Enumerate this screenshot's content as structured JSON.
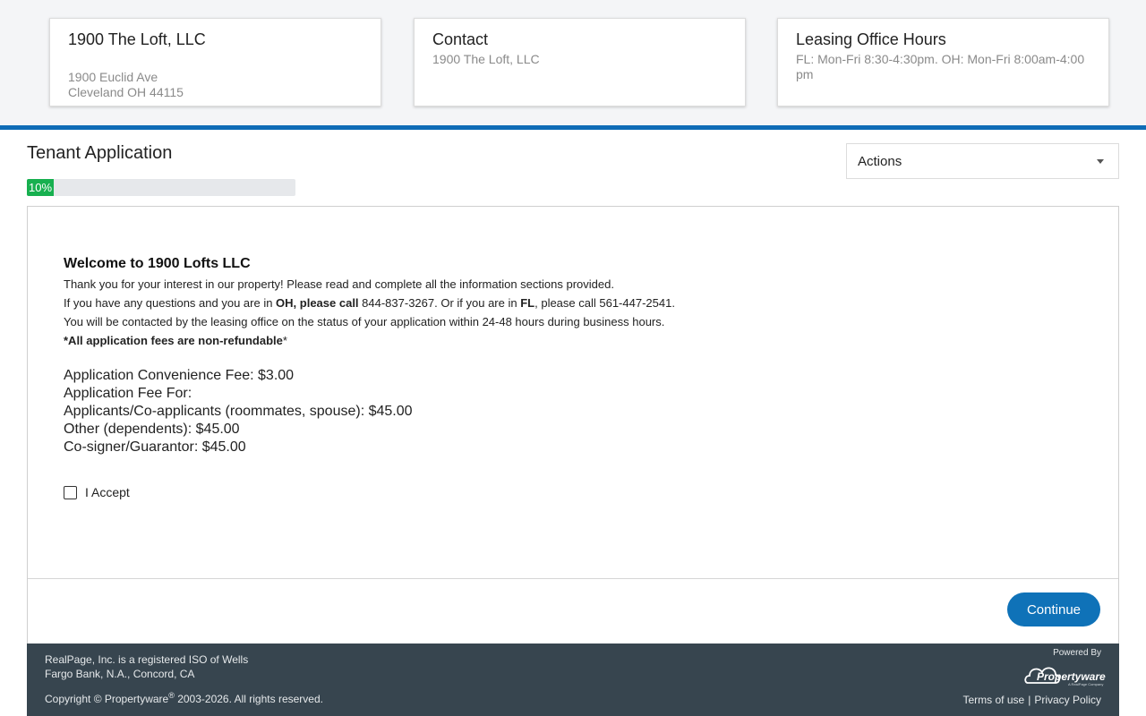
{
  "property_card": {
    "title": "1900 The Loft, LLC",
    "address_line1": "1900 Euclid Ave",
    "address_line2": "Cleveland OH 44115"
  },
  "contact_card": {
    "title": "Contact",
    "name": "1900 The Loft, LLC"
  },
  "hours_card": {
    "title": "Leasing Office Hours",
    "text": "FL: Mon-Fri 8:30-4:30pm. OH: Mon-Fri 8:00am-4:00pm"
  },
  "page": {
    "title": "Tenant Application",
    "progress_label": "10%",
    "progress_value": 0.1
  },
  "actions": {
    "label": "Actions"
  },
  "welcome": {
    "heading": "Welcome to 1900 Lofts LLC",
    "line1": "Thank you for your interest in our property! Please read and complete all the information sections provided.",
    "line2_prefix": "If you have any questions and you are in ",
    "line2_oh_bold": "OH, please call",
    "line2_oh_phone": " 844-837-3267. Or if you are in ",
    "line2_fl_bold": "FL",
    "line2_fl_rest": ", please call 561-447-2541.",
    "line3": "You will be contacted by the leasing office on the status of your application within 24-48 hours during business hours.",
    "line4_bold": "*All application fees are non-refundable",
    "line4_end": "*"
  },
  "fees": [
    "Application Convenience Fee: $3.00",
    "Application Fee For:",
    "Applicants/Co-applicants (roommates, spouse): $45.00",
    "Other (dependents): $45.00",
    "Co-signer/Guarantor: $45.00"
  ],
  "accept": {
    "label": "I Accept",
    "checked": false
  },
  "continue_button": {
    "label": "Continue"
  },
  "footer": {
    "iso_text": "RealPage, Inc. is a registered ISO of Wells Fargo Bank, N.A., Concord, CA",
    "copyright_prefix": "Copyright © Propertyware",
    "copyright_reg": "®",
    "copyright_suffix": " 2003-2026. All rights reserved.",
    "powered_by": "Powered By",
    "logo_name": "Propertyware",
    "logo_tagline": "A RealPage Company",
    "terms_label": "Terms of use",
    "separator": "|",
    "privacy_label": "Privacy Policy"
  },
  "colors": {
    "brand_blue": "#0f6cb6",
    "button_blue": "#0f72b8",
    "progress_green": "#17b04f",
    "footer_bg": "#37454f"
  }
}
